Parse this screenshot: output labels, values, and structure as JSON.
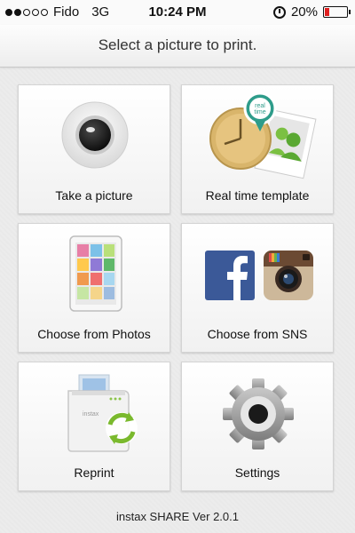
{
  "status_bar": {
    "signal_strength": 2,
    "carrier": "Fido",
    "network": "3G",
    "time": "10:24 PM",
    "battery_percent": "20%",
    "battery_level": 0.2,
    "battery_color": "#e02020",
    "icons": [
      "signal-dots",
      "alarm-icon",
      "battery-icon"
    ]
  },
  "header": {
    "title": "Select a picture to print."
  },
  "menu": {
    "take_picture": {
      "label": "Take a picture",
      "icon": "camera-icon"
    },
    "real_time_template": {
      "label": "Real time template",
      "icon": "real-time-template-icon",
      "badge_text": "real time"
    },
    "choose_photos": {
      "label": "Choose from Photos",
      "icon": "photos-tablet-icon"
    },
    "choose_sns": {
      "label": "Choose from SNS",
      "icon": "sns-icons",
      "facebook_color": "#3b5998"
    },
    "reprint": {
      "label": "Reprint",
      "icon": "printer-reprint-icon",
      "printer_text": "instax"
    },
    "settings": {
      "label": "Settings",
      "icon": "gear-icon"
    }
  },
  "footer": {
    "version": "instax SHARE Ver 2.0.1"
  }
}
